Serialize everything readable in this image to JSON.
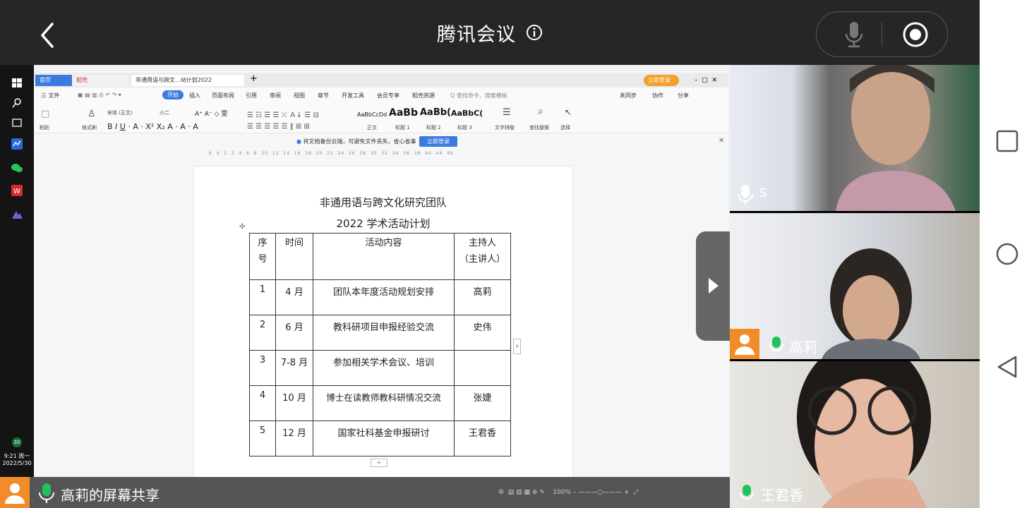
{
  "header": {
    "title": "腾讯会议"
  },
  "colors": {
    "accent": "#3a7be0",
    "speaking": "#21c25e",
    "avatar": "#f28c28"
  },
  "taskbar": {
    "time": "9:21 周一",
    "date": "2022/5/30",
    "temp": "30"
  },
  "wps": {
    "tabs": [
      {
        "label": "首页"
      },
      {
        "label": "稻壳"
      },
      {
        "label": "非通用语与跨文...动计划2022"
      }
    ],
    "login_badge": "立即登录",
    "menu": [
      "三 文件",
      "开始",
      "插入",
      "页面布局",
      "引用",
      "审阅",
      "视图",
      "章节",
      "开发工具",
      "会员专享",
      "稻壳资源",
      "Q 查找命令、搜索模板"
    ],
    "menu_right": [
      "未同步",
      "协作",
      "分享"
    ],
    "ribbon": {
      "font_name": "宋体 (正文)",
      "font_size": "小二",
      "styles": [
        {
          "preview": "AaBbCcDd",
          "label": "正文"
        },
        {
          "preview": "AaBb",
          "label": "标题 1"
        },
        {
          "preview": "AaBb(",
          "label": "标题 2"
        },
        {
          "preview": "AaBbC(",
          "label": "标题 3"
        }
      ],
      "tools": [
        "格式刷",
        "粘贴",
        "文字排版",
        "查找替换",
        "选择"
      ]
    },
    "notice": {
      "text": "将文档备份云端，可避免文件丢失，省心省事",
      "button": "立即登录"
    },
    "ruler": "6  4  2  2  4  6  8  10  12  14  16  18  20  22  24  26  28  30  32  34  36  38  40  44  46",
    "zoom": "100%"
  },
  "document": {
    "title": "非通用语与跨文化研究团队",
    "subtitle": "2022 学术活动计划",
    "table": {
      "headers": [
        [
          "序",
          "号"
        ],
        [
          "时间"
        ],
        [
          "活动内容"
        ],
        [
          "主持人",
          "（主讲人）"
        ]
      ],
      "rows": [
        {
          "no": "1",
          "time": "4 月",
          "content": "团队本年度活动规划安排",
          "host": "高莉"
        },
        {
          "no": "2",
          "time": "6 月",
          "content": "教科研项目申报经验交流",
          "host": "史伟"
        },
        {
          "no": "3",
          "time": "7-8 月",
          "content": "参加相关学术会议、培训",
          "host": ""
        },
        {
          "no": "4",
          "time": "10 月",
          "content": "博士在读教师教科研情况交流",
          "host": "张婕"
        },
        {
          "no": "5",
          "time": "12 月",
          "content": "国家社科基金申报研讨",
          "host": "王君香"
        }
      ]
    }
  },
  "share_status": {
    "label": "高莉的屏幕共享"
  },
  "participants": [
    {
      "name": "S",
      "muted": true
    },
    {
      "name": "高莉",
      "speaking": true
    },
    {
      "name": "王君香",
      "speaking": true
    }
  ]
}
